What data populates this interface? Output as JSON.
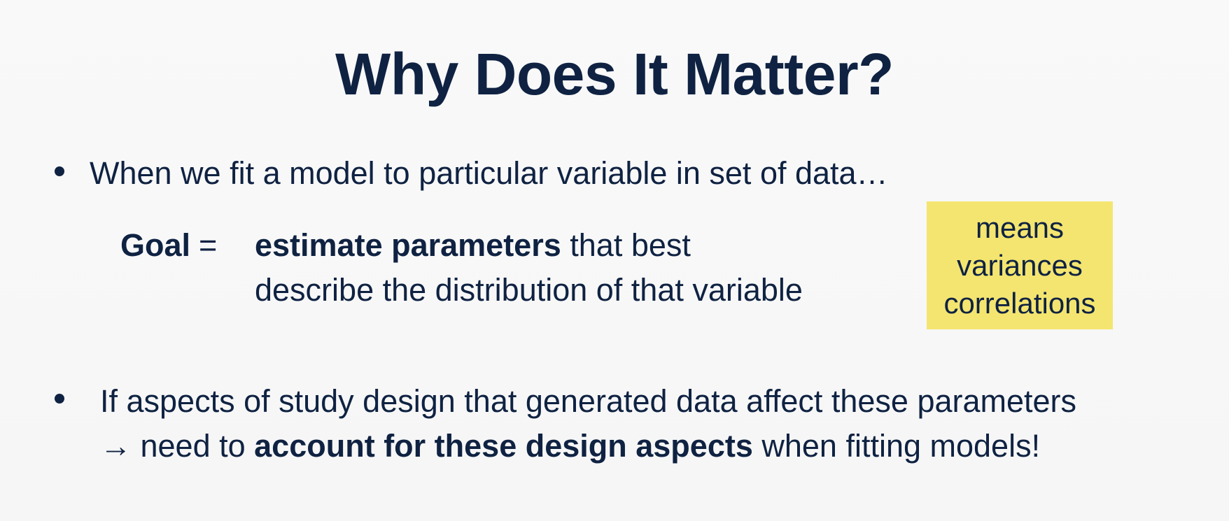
{
  "slide": {
    "title": "Why Does It Matter?",
    "bullet1": {
      "text": "When we fit a model to particular variable in set of data…"
    },
    "goal": {
      "label": "Goal",
      "equals": "=",
      "line1_bold": "estimate parameters",
      "line1_rest": "that best",
      "line2": "describe the distribution of that variable"
    },
    "callout": {
      "items": [
        "means",
        "variances",
        "correlations"
      ],
      "background": "#f4e570"
    },
    "bullet2": {
      "line1": "If aspects of study design that generated data affect these parameters",
      "line2_prefix": "→ need to ",
      "line2_bold": "account for these design aspects",
      "line2_suffix": " when fitting models!"
    }
  }
}
